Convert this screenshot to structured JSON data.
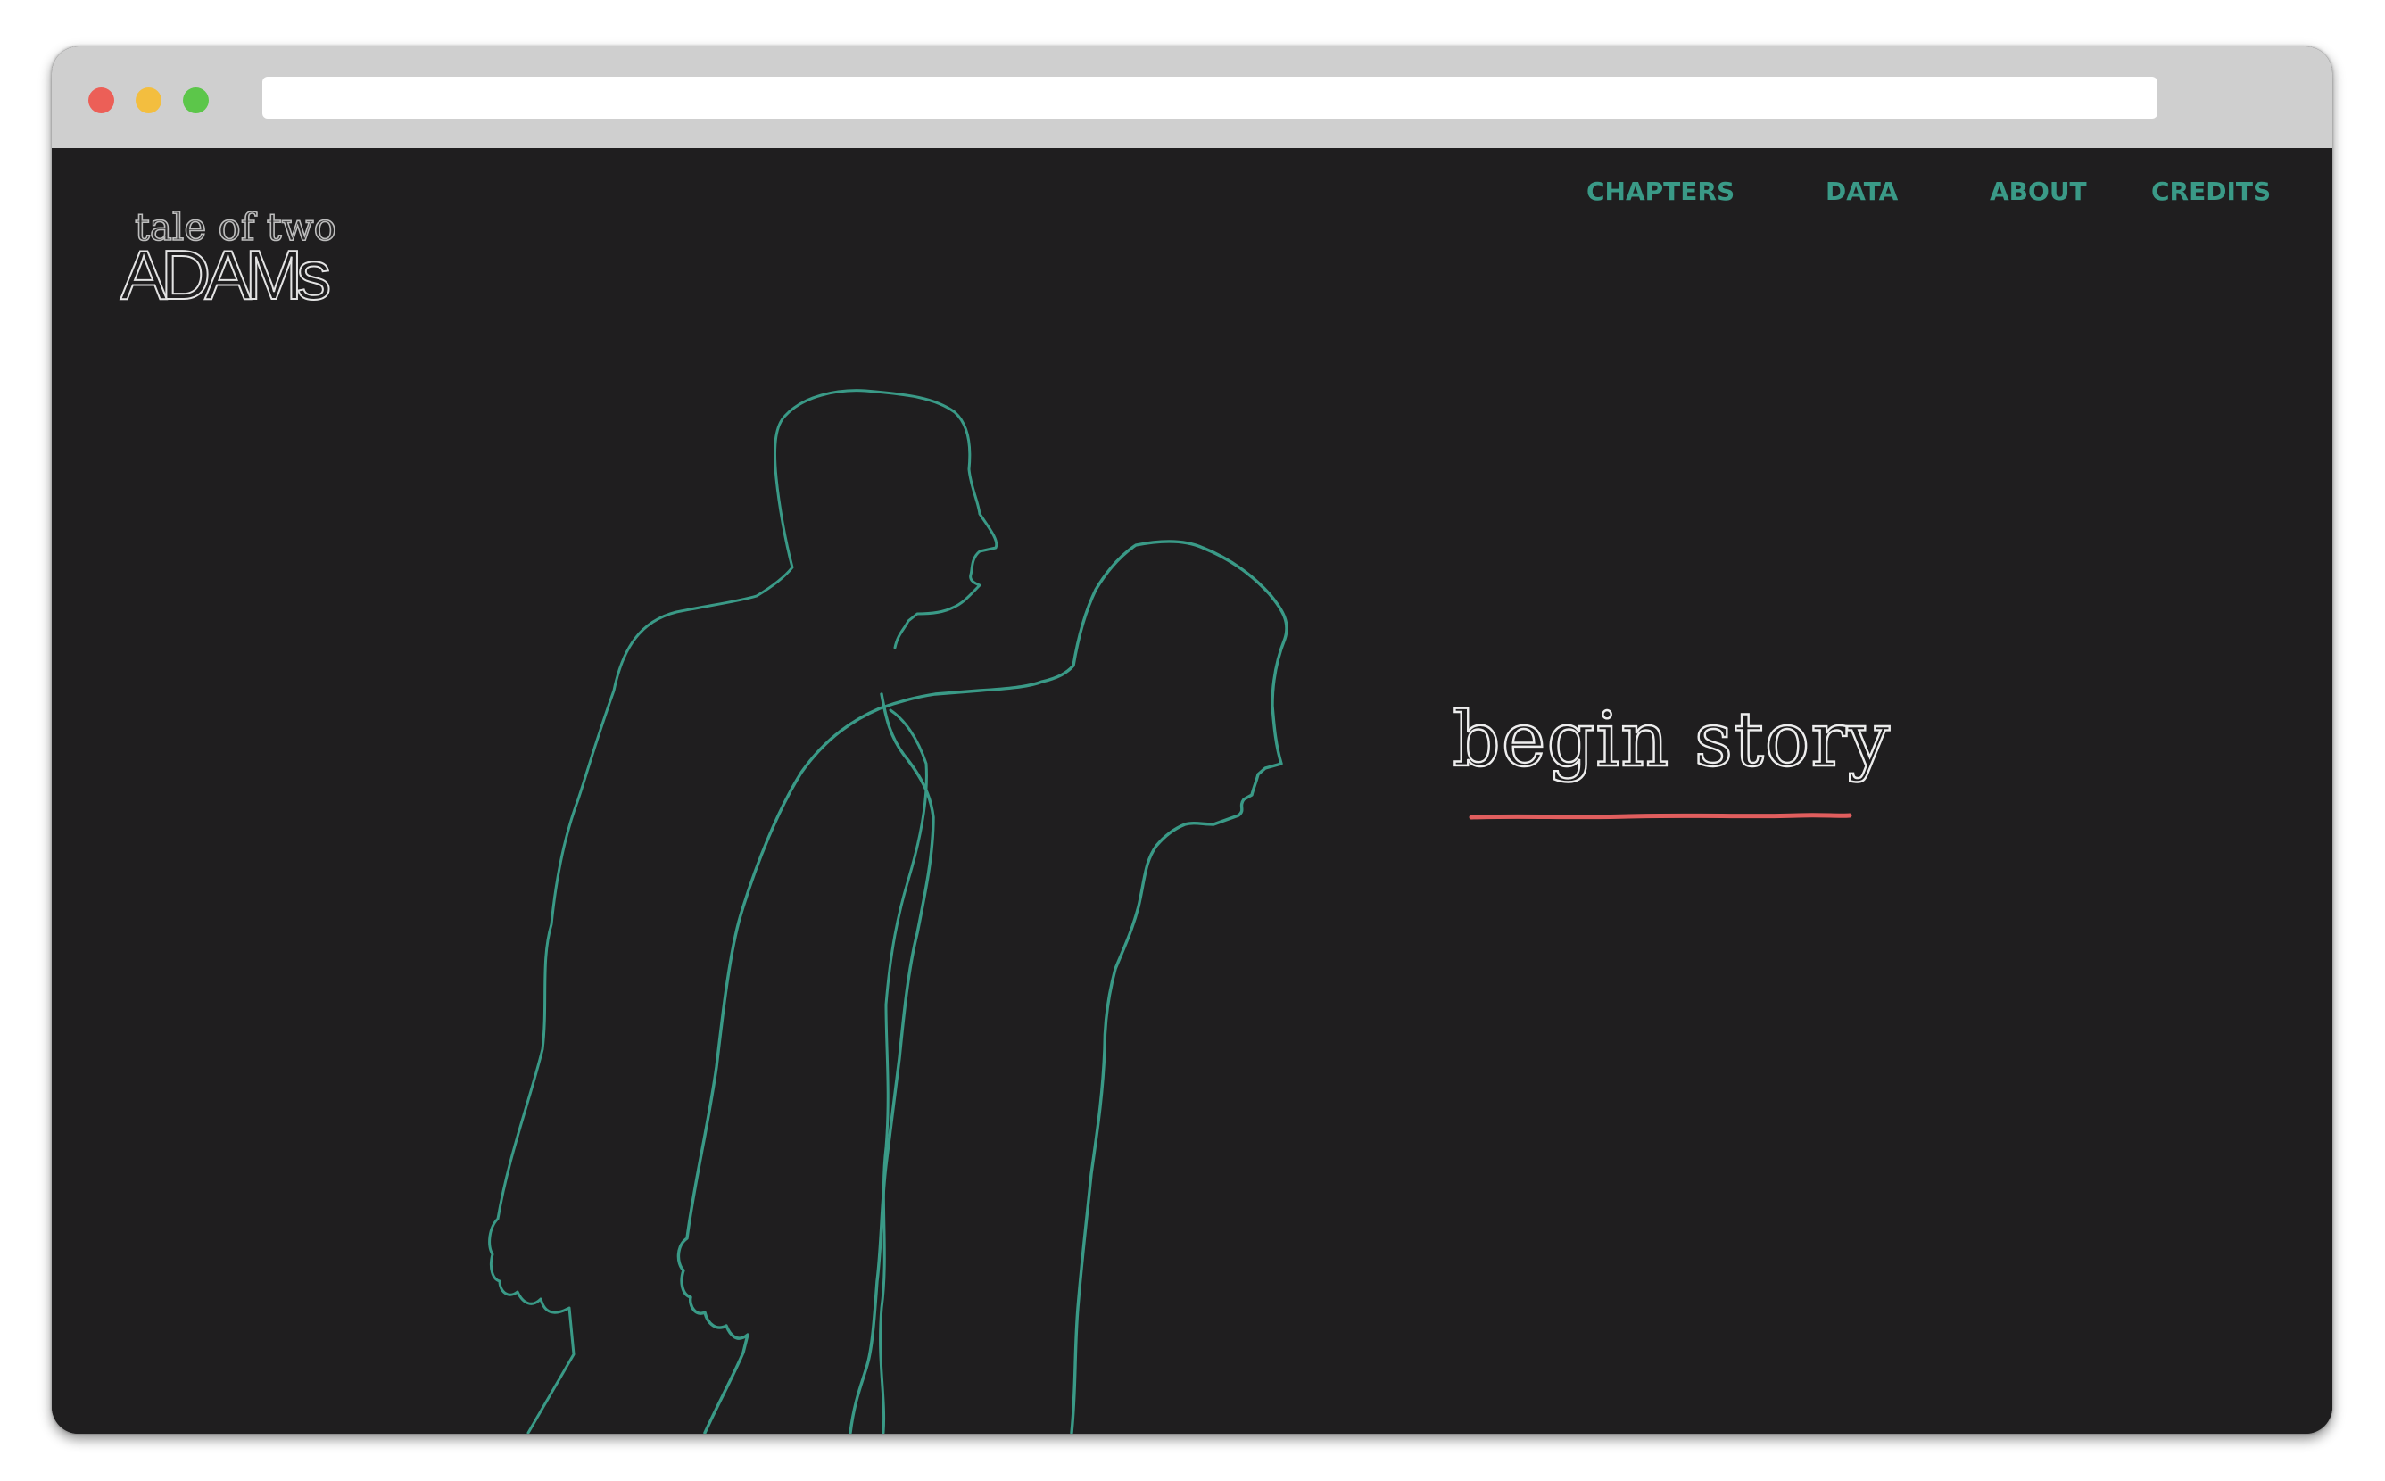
{
  "browser": {
    "url_value": "",
    "controls": [
      {
        "name": "close",
        "color": "#ec5f57"
      },
      {
        "name": "minimize",
        "color": "#f3be3f"
      },
      {
        "name": "zoom",
        "color": "#5cc64a"
      }
    ]
  },
  "site": {
    "logo": {
      "line1": "tale of two",
      "line2": "ADAMs"
    },
    "nav": [
      {
        "label": "CHAPTERS"
      },
      {
        "label": "DATA"
      },
      {
        "label": "ABOUT"
      },
      {
        "label": "CREDITS"
      }
    ],
    "cta": {
      "label": "begin story",
      "underline_color": "#e15e5e"
    },
    "illustration": {
      "subject": "two-men-silhouette-outline",
      "stroke_color": "#3a9a87"
    }
  },
  "colors": {
    "background": "#1f1e1f",
    "accent": "#3a9a87",
    "highlight": "#e15e5e",
    "chrome": "#cfcfcf"
  }
}
